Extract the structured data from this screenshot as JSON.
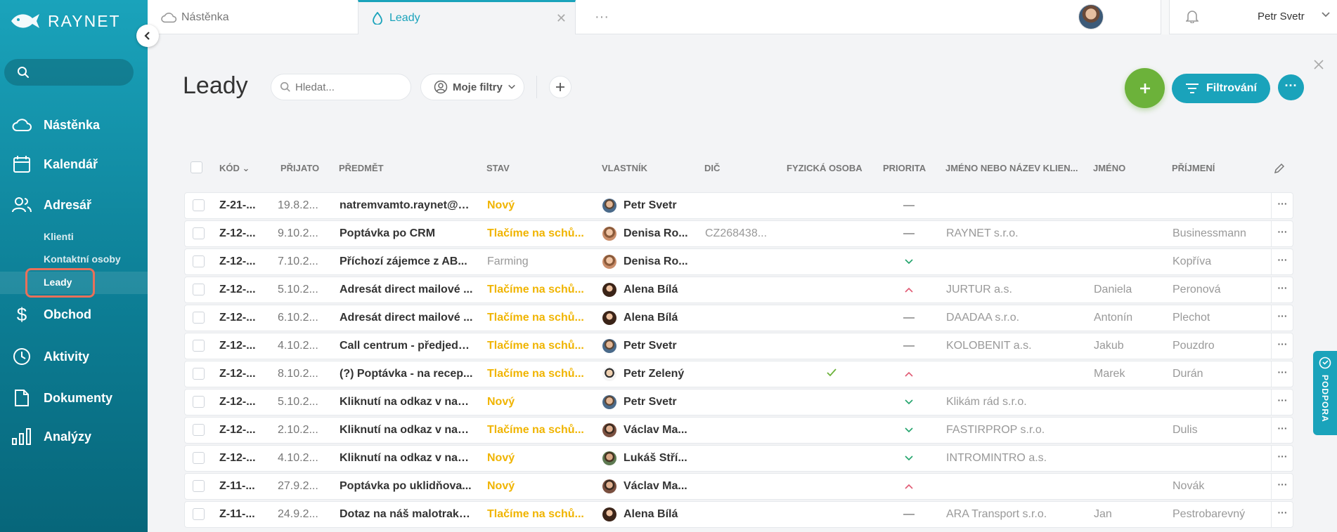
{
  "brand": {
    "name": "RAYNET"
  },
  "sidebar": {
    "search_placeholder": "",
    "items": [
      {
        "label": "Nástěnka",
        "icon": "cloud-icon"
      },
      {
        "label": "Kalendář",
        "icon": "calendar-icon"
      },
      {
        "label": "Adresář",
        "icon": "people-icon"
      },
      {
        "label": "Obchod",
        "icon": "dollar-icon"
      },
      {
        "label": "Aktivity",
        "icon": "clock-icon"
      },
      {
        "label": "Dokumenty",
        "icon": "document-icon"
      },
      {
        "label": "Analýzy",
        "icon": "bar-chart-icon"
      }
    ],
    "sub_items": [
      {
        "label": "Klienti"
      },
      {
        "label": "Kontaktní osoby"
      },
      {
        "label": "Leady",
        "selected": true
      }
    ]
  },
  "tabs": [
    {
      "label": "Nástěnka",
      "icon": "cloud-icon",
      "active": false
    },
    {
      "label": "Leady",
      "icon": "lead-drop-icon",
      "active": true
    }
  ],
  "user": {
    "name": "Petr Svetr"
  },
  "page": {
    "title": "Leady",
    "search_placeholder": "Hledat...",
    "filters_label": "Moje filtry",
    "filter_button": "Filtrování"
  },
  "colors": {
    "accent": "#1aa3bb",
    "add_button": "#6cb23a",
    "status_yellow": "#f0b400",
    "status_gray": "#999999",
    "priority_high": "#e05a73",
    "priority_low": "#21a36b",
    "highlight_box": "#e8705a"
  },
  "table": {
    "columns": [
      "KÓD",
      "PŘIJATO",
      "PŘEDMĚT",
      "STAV",
      "VLASTNÍK",
      "DIČ",
      "FYZICKÁ OSOBA",
      "PRIORITA",
      "JMÉNO NEBO NÁZEV KLIEN...",
      "JMÉNO",
      "PŘÍJMENÍ"
    ],
    "rows": [
      {
        "kod": "Z-21-...",
        "prijato": "19.8.2...",
        "predmet": "natremvamto.raynet@c...",
        "stav": "Nový",
        "stav_type": "new",
        "vlastnik": "Petr Svetr",
        "avatar": "av-m",
        "dic": "",
        "fyzicka": "",
        "priorita": "normal",
        "klient": "",
        "jmeno": "",
        "prijmeni": ""
      },
      {
        "kod": "Z-12-...",
        "prijato": "9.10.2...",
        "predmet": "Poptávka po CRM",
        "stav": "Tlačíme na schů...",
        "stav_type": "push",
        "vlastnik": "Denisa Ro...",
        "avatar": "av-f",
        "dic": "CZ268438...",
        "fyzicka": "",
        "priorita": "normal",
        "klient": "RAYNET s.r.o.",
        "jmeno": "",
        "prijmeni": "Businessmann"
      },
      {
        "kod": "Z-12-...",
        "prijato": "7.10.2...",
        "predmet": "Příchozí zájemce z AB...",
        "stav": "Farming",
        "stav_type": "farm",
        "vlastnik": "Denisa Ro...",
        "avatar": "av-f",
        "dic": "",
        "fyzicka": "",
        "priorita": "low",
        "klient": "",
        "jmeno": "",
        "prijmeni": "Kopříva"
      },
      {
        "kod": "Z-12-...",
        "prijato": "5.10.2...",
        "predmet": "Adresát direct mailové ...",
        "stav": "Tlačíme na schů...",
        "stav_type": "push",
        "vlastnik": "Alena Bílá",
        "avatar": "av-f2",
        "dic": "",
        "fyzicka": "",
        "priorita": "high",
        "klient": "JURTUR a.s.",
        "jmeno": "Daniela",
        "prijmeni": "Peronová"
      },
      {
        "kod": "Z-12-...",
        "prijato": "6.10.2...",
        "predmet": "Adresát direct mailové ...",
        "stav": "Tlačíme na schů...",
        "stav_type": "push",
        "vlastnik": "Alena Bílá",
        "avatar": "av-f2",
        "dic": "",
        "fyzicka": "",
        "priorita": "normal",
        "klient": "DAADAA s.r.o.",
        "jmeno": "Antonín",
        "prijmeni": "Plechot"
      },
      {
        "kod": "Z-12-...",
        "prijato": "4.10.2...",
        "predmet": "Call centrum - předjedn...",
        "stav": "Tlačíme na schů...",
        "stav_type": "push",
        "vlastnik": "Petr Svetr",
        "avatar": "av-m",
        "dic": "",
        "fyzicka": "",
        "priorita": "normal",
        "klient": "KOLOBENIT a.s.",
        "jmeno": "Jakub",
        "prijmeni": "Pouzdro"
      },
      {
        "kod": "Z-12-...",
        "prijato": "8.10.2...",
        "predmet": "(?) Poptávka - na recep...",
        "stav": "Tlačíme na schů...",
        "stav_type": "push",
        "vlastnik": "Petr Zelený",
        "avatar": "av-m2",
        "dic": "",
        "fyzicka": "check",
        "priorita": "high",
        "klient": "",
        "jmeno": "Marek",
        "prijmeni": "Durán"
      },
      {
        "kod": "Z-12-...",
        "prijato": "5.10.2...",
        "predmet": "Kliknutí na odkaz v naš...",
        "stav": "Nový",
        "stav_type": "new",
        "vlastnik": "Petr Svetr",
        "avatar": "av-m",
        "dic": "",
        "fyzicka": "",
        "priorita": "low",
        "klient": "Klikám rád s.r.o.",
        "jmeno": "",
        "prijmeni": ""
      },
      {
        "kod": "Z-12-...",
        "prijato": "2.10.2...",
        "predmet": "Kliknutí na odkaz v naš...",
        "stav": "Tlačíme na schů...",
        "stav_type": "push",
        "vlastnik": "Václav Ma...",
        "avatar": "av-m3",
        "dic": "",
        "fyzicka": "",
        "priorita": "low",
        "klient": "FASTIRPROP s.r.o.",
        "jmeno": "",
        "prijmeni": "Dulis"
      },
      {
        "kod": "Z-12-...",
        "prijato": "4.10.2...",
        "predmet": "Kliknutí na odkaz v naš...",
        "stav": "Nový",
        "stav_type": "new",
        "vlastnik": "Lukáš Stří...",
        "avatar": "av-m4",
        "dic": "",
        "fyzicka": "",
        "priorita": "low",
        "klient": "INTROMINTRO a.s.",
        "jmeno": "",
        "prijmeni": ""
      },
      {
        "kod": "Z-11-...",
        "prijato": "27.9.2...",
        "predmet": "Poptávka po uklidňova...",
        "stav": "Nový",
        "stav_type": "new",
        "vlastnik": "Václav Ma...",
        "avatar": "av-m3",
        "dic": "",
        "fyzicka": "",
        "priorita": "high",
        "klient": "",
        "jmeno": "",
        "prijmeni": "Novák"
      },
      {
        "kod": "Z-11-...",
        "prijato": "24.9.2...",
        "predmet": "Dotaz na náš malotraktor",
        "stav": "Tlačíme na schů...",
        "stav_type": "push",
        "vlastnik": "Alena Bílá",
        "avatar": "av-f2",
        "dic": "",
        "fyzicka": "",
        "priorita": "normal",
        "klient": "ARA Transport s.r.o.",
        "jmeno": "Jan",
        "prijmeni": "Pestrobarevný"
      }
    ]
  },
  "support": {
    "label": "PODPORA"
  }
}
